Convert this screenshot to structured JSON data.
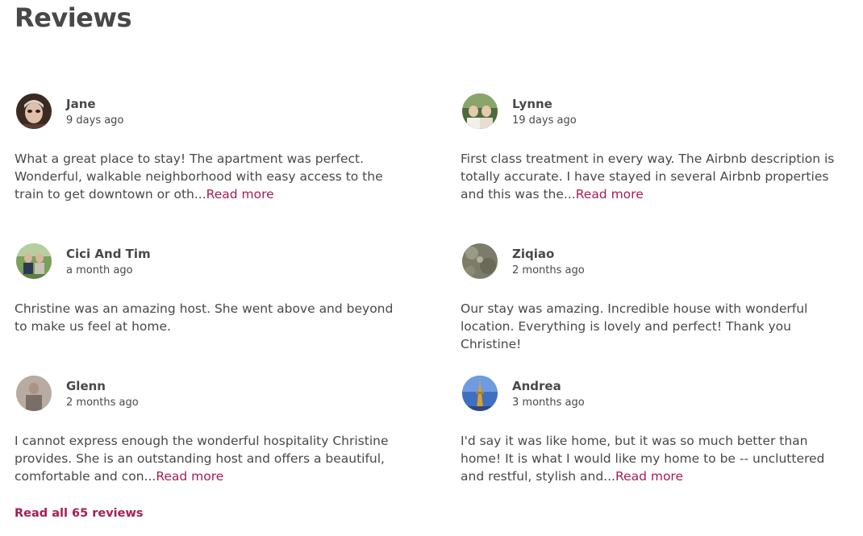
{
  "section": {
    "title": "Reviews",
    "read_all_label": "Read all 65 reviews"
  },
  "reviews": [
    {
      "name": "Jane",
      "date": "9 days ago",
      "text": "What a great place to stay! The apartment was perfect. Wonderful, walkable neighborhood with easy access to the train to get downtown or oth...",
      "read_more": "Read more"
    },
    {
      "name": "Lynne",
      "date": "19 days ago",
      "text": "First class treatment in every way. The Airbnb description is totally accurate. I have stayed in several Airbnb properties and this was the...",
      "read_more": "Read more"
    },
    {
      "name": "Cici And Tim",
      "date": "a month ago",
      "text": "Christine was an amazing host. She went above and beyond to make us feel at home."
    },
    {
      "name": "Ziqiao",
      "date": "2 months ago",
      "text": "Our stay was amazing. Incredible house with wonderful location. Everything is lovely and perfect! Thank you Christine!"
    },
    {
      "name": "Glenn",
      "date": "2 months ago",
      "text": "I cannot express enough the wonderful hospitality Christine provides. She is an outstanding host and offers a beautiful, comfortable and con...",
      "read_more": "Read more"
    },
    {
      "name": "Andrea",
      "date": "3 months ago",
      "text": "I'd say it was like home, but it was so much better than home! It is what I would like my home to be -- uncluttered and restful, stylish and...",
      "read_more": "Read more"
    }
  ],
  "colors": {
    "text": "#484848",
    "link": "#A61D55"
  }
}
